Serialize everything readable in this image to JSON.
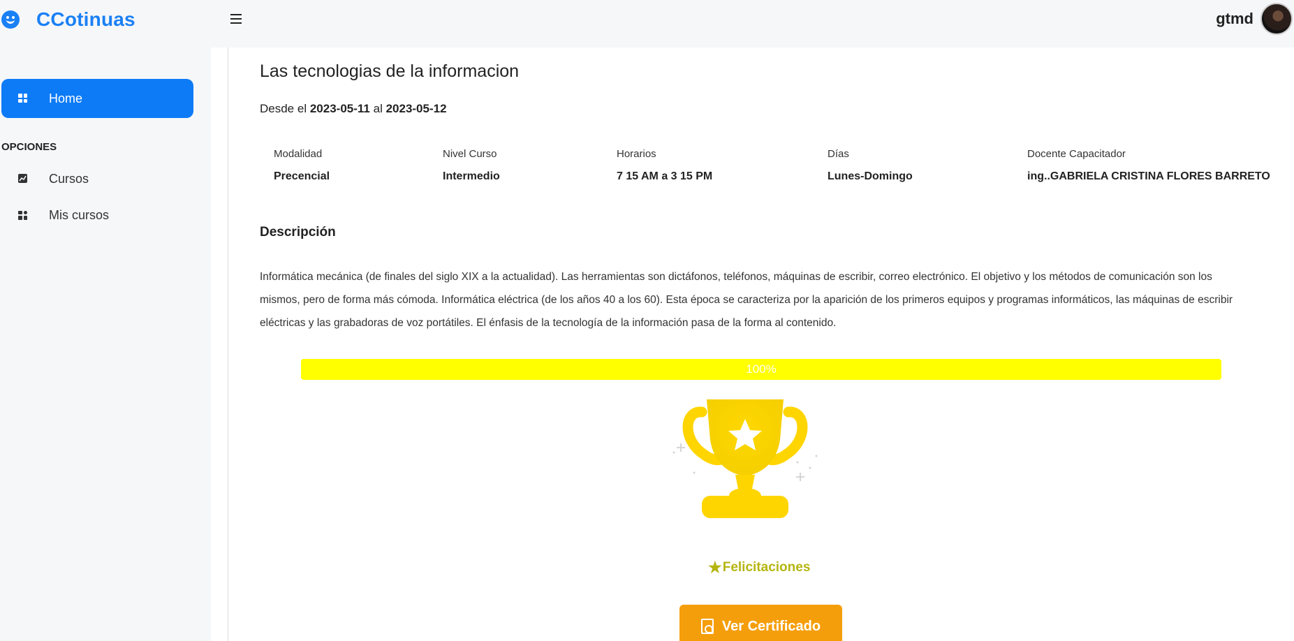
{
  "app": {
    "brand": "CCotinuas"
  },
  "header": {
    "user_name": "gtmd"
  },
  "sidebar": {
    "home_label": "Home",
    "section_label": "OPCIONES",
    "items": [
      {
        "label": "Cursos",
        "icon": "chart-icon"
      },
      {
        "label": "Mis cursos",
        "icon": "grid-icon"
      }
    ]
  },
  "course": {
    "title": "Las tecnologias de la informacion",
    "dates": {
      "prefix": "Desde el",
      "start": "2023-05-11",
      "middle": "al",
      "end": "2023-05-12"
    },
    "info": [
      {
        "key": "Modalidad",
        "value": "Precencial"
      },
      {
        "key": "Nivel Curso",
        "value": "Intermedio"
      },
      {
        "key": "Horarios",
        "value": "7 15 AM a 3 15 PM"
      },
      {
        "key": "Días",
        "value": "Lunes-Domingo"
      },
      {
        "key": "Docente Capacitador",
        "value": "ing..GABRIELA CRISTINA FLORES BARRETO"
      }
    ],
    "description_title": "Descripción",
    "description": "Informática mecánica (de finales del siglo XIX a la actualidad). Las herramientas son dictáfonos, teléfonos, máquinas de escribir, correo electrónico. El objetivo y los métodos de comunicación son los mismos, pero de forma más cómoda. Informática eléctrica (de los años 40 a los 60). Esta época se caracteriza por la aparición de los primeros equipos y programas informáticos, las máquinas de escribir eléctricas y las grabadoras de voz portátiles. El énfasis de la tecnología de la información pasa de la forma al contenido.",
    "progress": {
      "value": 100,
      "label": "100%",
      "color": "#ffff00"
    },
    "congrats": "Felicitaciones",
    "certificate_button": "Ver Certificado"
  },
  "colors": {
    "primary": "#0d7bf6",
    "trophy": "#ffd500",
    "button": "#f59e0b",
    "congrats": "#b5b511"
  }
}
